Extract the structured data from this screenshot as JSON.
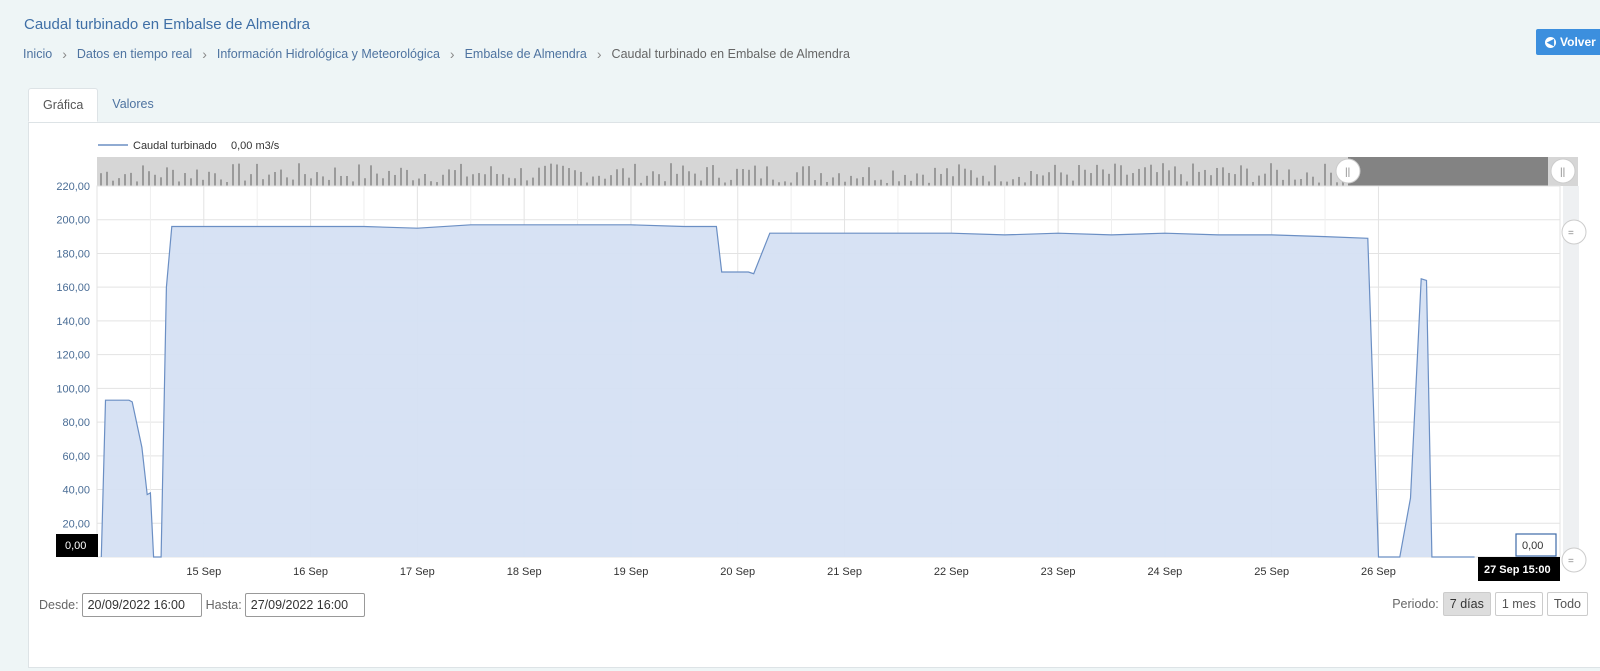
{
  "header": {
    "title": "Caudal turbinado en Embalse de Almendra",
    "back_label": "Volver"
  },
  "breadcrumb": [
    "Inicio",
    "Datos en tiempo real",
    "Información Hidrológica y Meteorológica",
    "Embalse de Almendra",
    "Caudal turbinado en Embalse de Almendra"
  ],
  "tabs": [
    "Gráfica",
    "Valores"
  ],
  "colors": {
    "series": "#6b8fc4",
    "fill": "#d5e0f3",
    "navigator": "#9a9a9a"
  },
  "chart_data": {
    "type": "area",
    "legend": {
      "name": "Caudal turbinado",
      "value": "0,00 m3/s"
    },
    "ylim": [
      0,
      220
    ],
    "yticks": [
      "0,00",
      "20,00",
      "40,00",
      "60,00",
      "80,00",
      "100,00",
      "120,00",
      "140,00",
      "160,00",
      "180,00",
      "200,00",
      "220,00"
    ],
    "xlabels": [
      "15 Sep",
      "16 Sep",
      "17 Sep",
      "18 Sep",
      "19 Sep",
      "20 Sep",
      "21 Sep",
      "22 Sep",
      "23 Sep",
      "24 Sep",
      "25 Sep",
      "26 Sep"
    ],
    "x_day_range": [
      14.0,
      27.7
    ],
    "series": {
      "x": [
        14.04,
        14.08,
        14.3,
        14.33,
        14.42,
        14.47,
        14.5,
        14.53,
        14.56,
        14.6,
        14.65,
        14.7,
        15.0,
        15.5,
        16.0,
        16.5,
        17.0,
        17.5,
        18.0,
        18.5,
        19.0,
        19.5,
        19.8,
        19.85,
        19.9,
        20.1,
        20.15,
        20.3,
        20.5,
        21.0,
        21.5,
        22.0,
        22.5,
        23.0,
        23.5,
        24.0,
        24.5,
        25.0,
        25.5,
        25.9,
        26.0,
        26.05,
        26.1,
        26.2,
        26.3,
        26.4,
        26.45,
        26.5,
        26.55,
        26.6,
        26.65,
        26.9
      ],
      "y": [
        0,
        93,
        93,
        92,
        65,
        37,
        38,
        0,
        0,
        0,
        160,
        196,
        196,
        196,
        196,
        196,
        195,
        197,
        197,
        197,
        197,
        196,
        196,
        169,
        169,
        169,
        168,
        192,
        192,
        192,
        192,
        192,
        191,
        192,
        191,
        192,
        191,
        191,
        190,
        189,
        0,
        0,
        0,
        0,
        35,
        165,
        164,
        0,
        0,
        0,
        0,
        0
      ]
    },
    "tooltip_value": "0,00",
    "crosshair_label": "27 Sep 15:00"
  },
  "range": {
    "from_label": "Desde:",
    "from_value": "20/09/2022 16:00",
    "to_label": "Hasta:",
    "to_value": "27/09/2022 16:00"
  },
  "period": {
    "label": "Periodo:",
    "options": [
      "7 días",
      "1 mes",
      "Todo"
    ],
    "selected": "7 días"
  }
}
